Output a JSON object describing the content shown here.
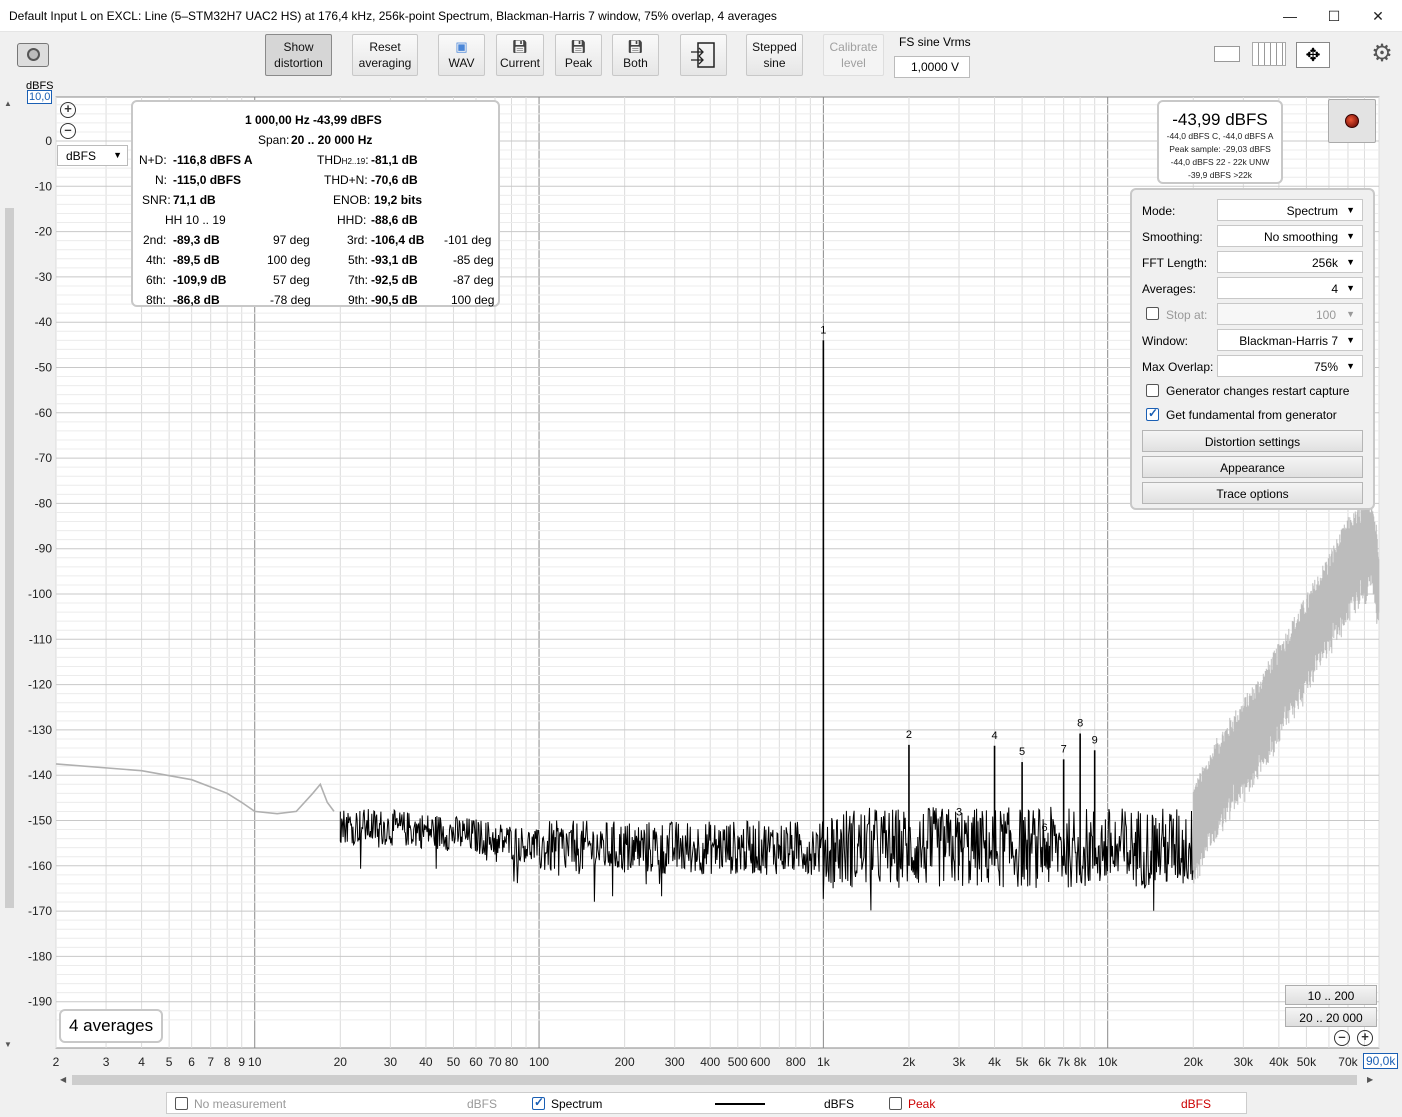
{
  "window": {
    "title": "Default Input L on EXCL: Line (5–STM32H7 UAC2 HS) at 176,4 kHz, 256k-point Spectrum, Blackman-Harris 7 window, 75% overlap, 4 averages",
    "min_icon": "minimize-icon",
    "max_icon": "maximize-icon",
    "close_icon": "close-icon"
  },
  "toolbar": {
    "show_distortion": [
      "Show",
      "distortion"
    ],
    "reset_averaging": [
      "Reset",
      "averaging"
    ],
    "wav": "WAV",
    "current": "Current",
    "peak": "Peak",
    "both": "Both",
    "stepped_sine": [
      "Stepped",
      "sine"
    ],
    "calibrate_level": [
      "Calibrate",
      "level"
    ],
    "fs_sine_label": "FS sine Vrms",
    "fs_sine_value": "1,0000 V"
  },
  "axis": {
    "unit_label": "dBFS",
    "top_value": "10,0",
    "right_value": "90,0k",
    "unit_dropdown": "dBFS"
  },
  "readout": {
    "freq_line": "1 000,00 Hz  -43,99 dBFS",
    "span_label": "Span:",
    "span_value": "20 .. 20 000 Hz",
    "nd_label": "N+D:",
    "nd_value": "-116,8 dBFS A",
    "thd_label": "THD",
    "thd_sub": "H2..19",
    "thd_colon": ":",
    "thd_value": "-81,1 dB",
    "n_label": "N:",
    "n_value": "-115,0 dBFS",
    "thdn_label": "THD+N:",
    "thdn_value": "-70,6 dB",
    "snr_label": "SNR:",
    "snr_value": "71,1 dB",
    "enob_label": "ENOB:",
    "enob_value": "19,2 bits",
    "hh_label": "HH 10 .. 19",
    "hhd_label": "HHD:",
    "hhd_value": "-88,6 dB",
    "harmonics": [
      {
        "label": "2nd:",
        "db": "-89,3 dB",
        "deg": "97 deg"
      },
      {
        "label": "3rd:",
        "db": "-106,4 dB",
        "deg": "-101 deg"
      },
      {
        "label": "4th:",
        "db": "-89,5 dB",
        "deg": "100 deg"
      },
      {
        "label": "5th:",
        "db": "-93,1 dB",
        "deg": "-85 deg"
      },
      {
        "label": "6th:",
        "db": "-109,9 dB",
        "deg": "57 deg"
      },
      {
        "label": "7th:",
        "db": "-92,5 dB",
        "deg": "-87 deg"
      },
      {
        "label": "8th:",
        "db": "-86,8 dB",
        "deg": "-78 deg"
      },
      {
        "label": "9th:",
        "db": "-90,5 dB",
        "deg": "100 deg"
      }
    ]
  },
  "peak_box": {
    "main": "-43,99 dBFS",
    "lines": [
      "-44,0 dBFS C, -44,0 dBFS A",
      "Peak sample: -29,03 dBFS",
      "-44,0 dBFS 22 - 22k UNW",
      "-39,9 dBFS >22k"
    ]
  },
  "settings": {
    "mode_label": "Mode:",
    "mode_value": "Spectrum",
    "smoothing_label": "Smoothing:",
    "smoothing_value": "No smoothing",
    "fft_label": "FFT Length:",
    "fft_value": "256k",
    "averages_label": "Averages:",
    "averages_value": "4",
    "stop_label": "Stop at:",
    "stop_value": "100",
    "window_label": "Window:",
    "window_value": "Blackman-Harris 7",
    "overlap_label": "Max Overlap:",
    "overlap_value": "75%",
    "gen_restart": "Generator changes restart capture",
    "gen_restart_checked": false,
    "fund_from_gen": "Get fundamental from generator",
    "fund_from_gen_checked": true,
    "distortion_settings": "Distortion settings",
    "appearance": "Appearance",
    "trace_options": "Trace options"
  },
  "range_buttons": [
    "10 .. 200",
    "20 .. 20 000"
  ],
  "averages_badge": "4 averages",
  "legend": {
    "no_measurement": "No measurement",
    "no_measurement_unit": "dBFS",
    "spectrum": "Spectrum",
    "spectrum_checked": true,
    "spectrum_unit": "dBFS",
    "peak": "Peak",
    "peak_unit": "dBFS",
    "peak_color": "#cc0000",
    "trace_color": "#000000"
  },
  "chart_data": {
    "type": "line",
    "x_scale": "log",
    "xlim": [
      2,
      90000
    ],
    "ylim": [
      -195,
      10
    ],
    "ylabel": "dBFS",
    "y_ticks": [
      0,
      -10,
      -20,
      -30,
      -40,
      -50,
      -60,
      -70,
      -80,
      -90,
      -100,
      -110,
      -120,
      -130,
      -140,
      -150,
      -160,
      -170,
      -180,
      -190
    ],
    "x_ticks": [
      {
        "v": 2,
        "t": "2"
      },
      {
        "v": 3,
        "t": "3"
      },
      {
        "v": 4,
        "t": "4"
      },
      {
        "v": 5,
        "t": "5"
      },
      {
        "v": 6,
        "t": "6"
      },
      {
        "v": 7,
        "t": "7"
      },
      {
        "v": 8,
        "t": "8"
      },
      {
        "v": 9,
        "t": "9"
      },
      {
        "v": 10,
        "t": "10"
      },
      {
        "v": 20,
        "t": "20"
      },
      {
        "v": 30,
        "t": "30"
      },
      {
        "v": 40,
        "t": "40"
      },
      {
        "v": 50,
        "t": "50"
      },
      {
        "v": 60,
        "t": "60"
      },
      {
        "v": 70,
        "t": "70"
      },
      {
        "v": 80,
        "t": "80"
      },
      {
        "v": 100,
        "t": "100"
      },
      {
        "v": 200,
        "t": "200"
      },
      {
        "v": 300,
        "t": "300"
      },
      {
        "v": 400,
        "t": "400"
      },
      {
        "v": 500,
        "t": "500"
      },
      {
        "v": 600,
        "t": "600"
      },
      {
        "v": 800,
        "t": "800"
      },
      {
        "v": 1000,
        "t": "1k"
      },
      {
        "v": 2000,
        "t": "2k"
      },
      {
        "v": 3000,
        "t": "3k"
      },
      {
        "v": 4000,
        "t": "4k"
      },
      {
        "v": 5000,
        "t": "5k"
      },
      {
        "v": 6000,
        "t": "6k"
      },
      {
        "v": 7000,
        "t": "7k"
      },
      {
        "v": 8000,
        "t": "8k"
      },
      {
        "v": 10000,
        "t": "10k"
      },
      {
        "v": 20000,
        "t": "20k"
      },
      {
        "v": 30000,
        "t": "30k"
      },
      {
        "v": 40000,
        "t": "40k"
      },
      {
        "v": 50000,
        "t": "50k"
      },
      {
        "v": 70000,
        "t": "70k"
      },
      {
        "v": 90000,
        "t": "90k"
      }
    ],
    "noise_floor_db": -156,
    "fundamental": {
      "freq": 1000,
      "db": -43.99
    },
    "harmonic_markers": [
      {
        "n": "1",
        "freq": 1000,
        "db": -43.99
      },
      {
        "n": "2",
        "freq": 2000,
        "db": -133.3
      },
      {
        "n": "3",
        "freq": 3000,
        "db": -150.4
      },
      {
        "n": "4",
        "freq": 4000,
        "db": -133.5
      },
      {
        "n": "5",
        "freq": 5000,
        "db": -137.1
      },
      {
        "n": "6",
        "freq": 6000,
        "db": -153.9
      },
      {
        "n": "7",
        "freq": 7000,
        "db": -136.5
      },
      {
        "n": "8",
        "freq": 8000,
        "db": -130.8
      },
      {
        "n": "9",
        "freq": 9000,
        "db": -134.5
      }
    ],
    "low_freq_gray": [
      [
        2,
        -137.5
      ],
      [
        4,
        -139
      ],
      [
        6,
        -141
      ],
      [
        8,
        -144
      ],
      [
        9,
        -146
      ],
      [
        10,
        -148
      ],
      [
        12,
        -148.5
      ],
      [
        14,
        -148
      ],
      [
        16,
        -144
      ],
      [
        17,
        -142
      ],
      [
        18,
        -146
      ],
      [
        19,
        -148
      ]
    ],
    "out_of_band_rise": [
      [
        20000,
        -152
      ],
      [
        25000,
        -140
      ],
      [
        35000,
        -127
      ],
      [
        50000,
        -110
      ],
      [
        70000,
        -93
      ],
      [
        85000,
        -88
      ],
      [
        90000,
        -98
      ]
    ]
  }
}
